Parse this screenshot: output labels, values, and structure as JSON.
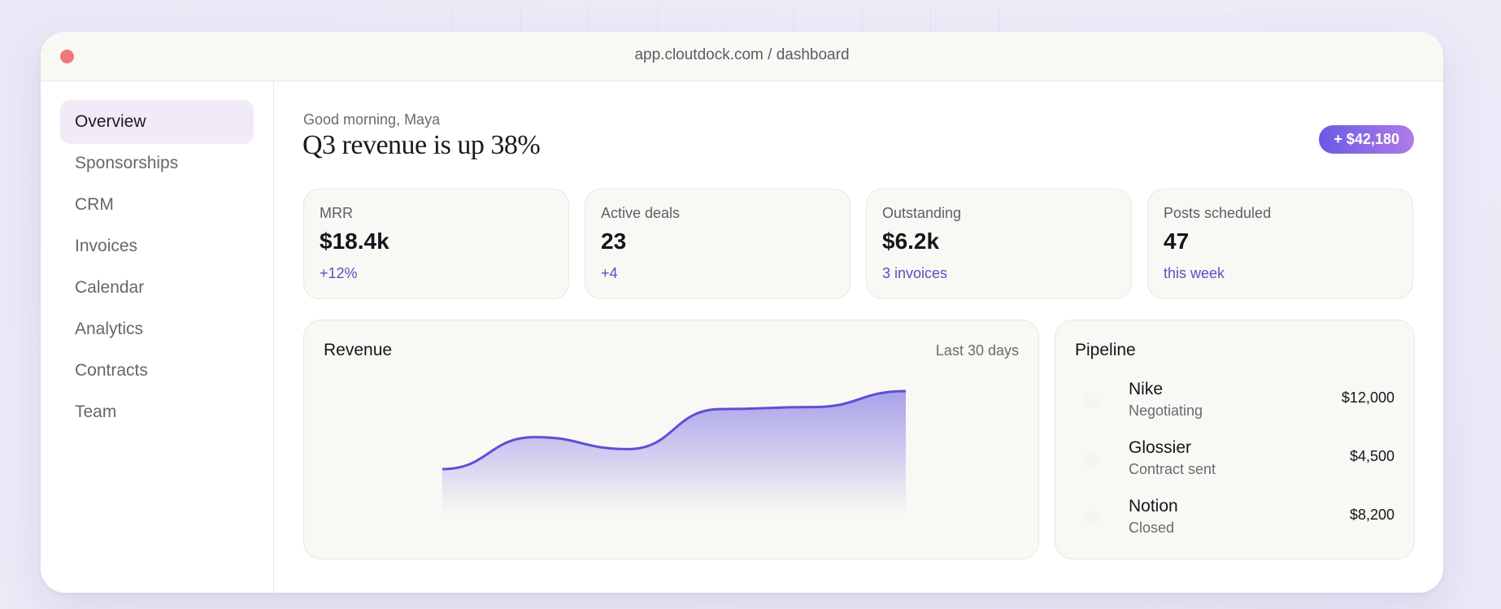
{
  "window": {
    "url": "app.cloutdock.com / dashboard"
  },
  "sidebar": {
    "items": [
      {
        "label": "Overview",
        "active": true
      },
      {
        "label": "Sponsorships"
      },
      {
        "label": "CRM"
      },
      {
        "label": "Invoices"
      },
      {
        "label": "Calendar"
      },
      {
        "label": "Analytics"
      },
      {
        "label": "Contracts"
      },
      {
        "label": "Team"
      }
    ]
  },
  "header": {
    "greeting": "Good morning, Maya",
    "headline": "Q3 revenue is up 38%",
    "badge": "+ $42,180"
  },
  "stats": [
    {
      "label": "MRR",
      "value": "$18.4k",
      "sub": "+12%"
    },
    {
      "label": "Active deals",
      "value": "23",
      "sub": "+4"
    },
    {
      "label": "Outstanding",
      "value": "$6.2k",
      "sub": "3 invoices"
    },
    {
      "label": "Posts scheduled",
      "value": "47",
      "sub": "this week"
    }
  ],
  "revenue": {
    "title": "Revenue",
    "range": "Last 30 days",
    "line_color": "#5b50d6"
  },
  "chart_data": {
    "type": "area",
    "points": [
      {
        "x": 0,
        "y": 22
      },
      {
        "x": 1,
        "y": 54
      },
      {
        "x": 2,
        "y": 42
      },
      {
        "x": 3,
        "y": 82
      },
      {
        "x": 4,
        "y": 84
      },
      {
        "x": 5,
        "y": 100
      }
    ],
    "ylim": [
      0,
      100
    ]
  },
  "pipeline": {
    "title": "Pipeline",
    "deals": [
      {
        "name": "Nike",
        "stage": "Negotiating",
        "amount": "$12,000"
      },
      {
        "name": "Glossier",
        "stage": "Contract sent",
        "amount": "$4,500"
      },
      {
        "name": "Notion",
        "stage": "Closed",
        "amount": "$8,200"
      }
    ]
  },
  "colors": {
    "accent": "#5b50d6",
    "badge_start": "#6a5ae6",
    "badge_end": "#b07be6",
    "close": "#ec7a78"
  }
}
